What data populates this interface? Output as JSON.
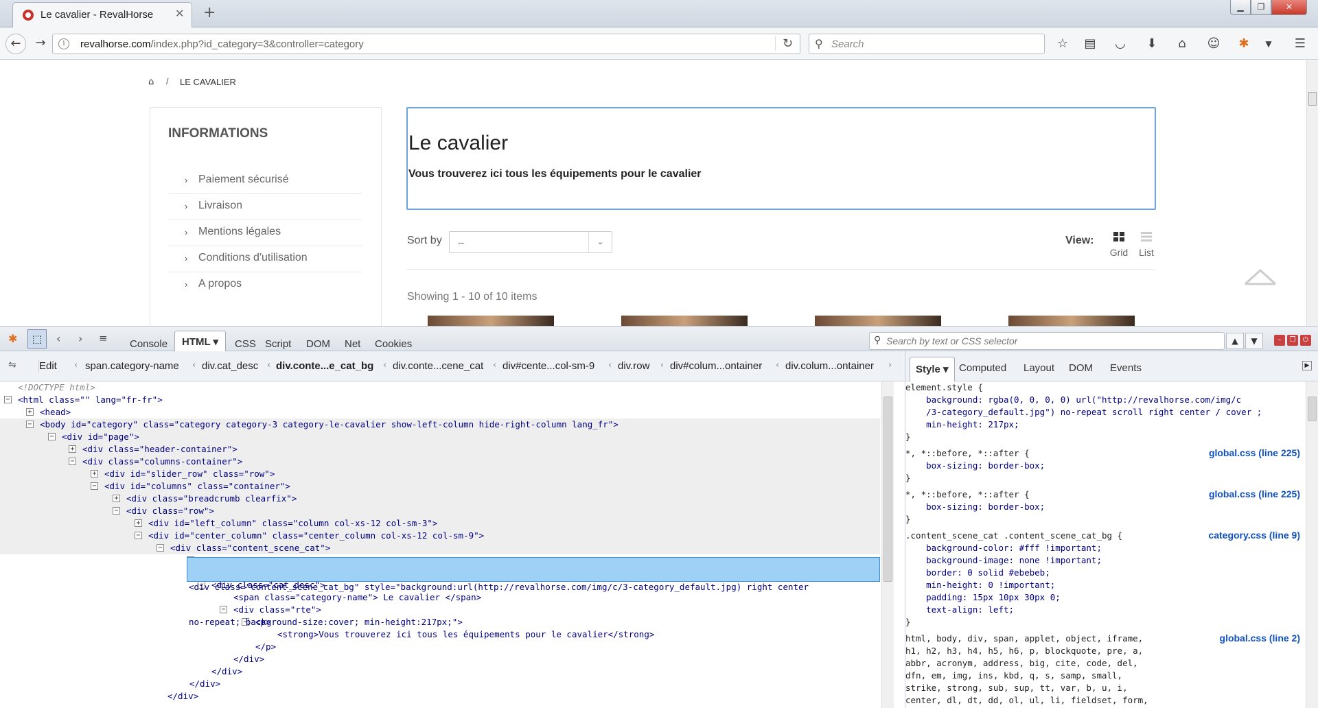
{
  "browser": {
    "tab_title": "Le cavalier - RevalHorse",
    "url_host": "revalhorse.com",
    "url_path": "/index.php?id_category=3&controller=category",
    "search_placeholder": "Search"
  },
  "page": {
    "breadcrumb_current": "LE CAVALIER",
    "breadcrumb_sep": "/",
    "informations_title": "INFORMATIONS",
    "info_items": [
      "Paiement sécurisé",
      "Livraison",
      "Mentions légales",
      "Conditions d'utilisation",
      "A propos"
    ],
    "category_name": "Le cavalier",
    "category_desc": "Vous trouverez ici tous les équipements pour le cavalier",
    "sort_label": "Sort by",
    "sort_value": "--",
    "view_label": "View:",
    "view_grid": "Grid",
    "view_list": "List",
    "showing": "Showing 1 - 10 of 10 items"
  },
  "devtools": {
    "tabs": [
      "Console",
      "HTML",
      "CSS",
      "Script",
      "DOM",
      "Net",
      "Cookies"
    ],
    "search_placeholder": "Search by text or CSS selector",
    "edit_label": "Edit",
    "breadcrumbs": [
      "span.category-name",
      "div.cat_desc",
      "div.conte...e_cat_bg",
      "div.conte...cene_cat",
      "div#cente...col-sm-9",
      "div.row",
      "div#colum...ontainer",
      "div.colum...ontainer"
    ],
    "side_tabs": [
      "Style",
      "Computed",
      "Layout",
      "DOM",
      "Events"
    ],
    "html_lines": [
      "<!DOCTYPE html>",
      "<html class=\"\" lang=\"fr-fr\">",
      "<head>",
      "<body id=\"category\" class=\"category category-3 category-le-cavalier show-left-column hide-right-column lang_fr\">",
      "<div id=\"page\">",
      "<div class=\"header-container\">",
      "<div class=\"columns-container\">",
      "<div id=\"slider_row\" class=\"row\">",
      "<div id=\"columns\" class=\"container\">",
      "<div class=\"breadcrumb clearfix\">",
      "<div class=\"row\">",
      "<div id=\"left_column\" class=\"column col-xs-12 col-sm-3\">",
      "<div id=\"center_column\" class=\"center_column col-xs-12 col-sm-9\">",
      "<div class=\"content_scene_cat\">",
      "<div class=\"cat_desc\">",
      "<span class=\"category-name\"> Le cavalier </span>",
      "<div class=\"rte\">",
      "<p>",
      "<strong>Vous trouverez ici tous les équipements pour le cavalier</strong>",
      "</p>",
      "</div>",
      "</div>",
      "</div>",
      "</div>"
    ],
    "selected_line_1": "<div class=\"content_scene_cat_bg\" style=\"background:url(http://revalhorse.com/img/c/3-category_default.jpg) right center",
    "selected_line_2": "no-repeat; background-size:cover; min-height:217px;\">",
    "css_lines": [
      "element.style {",
      "    background: rgba(0, 0, 0, 0) url(\"http://revalhorse.com/img/c",
      "    /3-category_default.jpg\") no-repeat scroll right center / cover ;",
      "    min-height: 217px;",
      "}",
      "*, *::before, *::after {",
      "    box-sizing: border-box;",
      "}",
      "*, *::before, *::after {",
      "    box-sizing: border-box;",
      "}",
      ".content_scene_cat .content_scene_cat_bg {",
      "    background-color: #fff !important;",
      "    background-image: none !important;",
      "    border: 0 solid #ebebeb;",
      "    min-height: 0 !important;",
      "    padding: 15px 10px 30px 0;",
      "    text-align: left;",
      "}",
      "html, body, div, span, applet, object, iframe,",
      "h1, h2, h3, h4, h5, h6, p, blockquote, pre, a,",
      "abbr, acronym, address, big, cite, code, del,",
      "dfn, em, img, ins, kbd, q, s, samp, small,",
      "strike, strong, sub, sup, tt, var, b, u, i,",
      "center, dl, dt, dd, ol, ul, li, fieldset, form,"
    ],
    "css_sources": [
      "global.css (line 225)",
      "global.css (line 225)",
      "category.css (line 9)",
      "global.css (line 2)"
    ]
  }
}
